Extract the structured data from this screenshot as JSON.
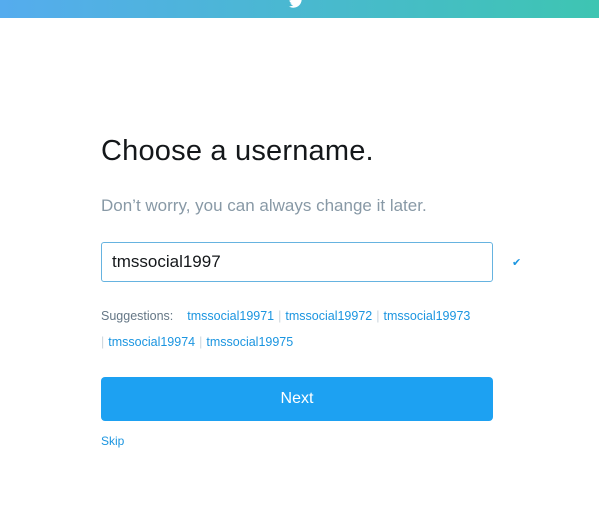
{
  "header": {
    "logo_icon": "twitter-bird-icon",
    "gradient_start": "#55acee",
    "gradient_end": "#3ec5b2"
  },
  "main": {
    "title": "Choose a username.",
    "subtitle": "Don’t worry, you can always change it later.",
    "username_value": "tmssocial1997",
    "valid_icon": "checkmark-icon",
    "suggestions_label": "Suggestions:",
    "suggestions": [
      "tmssocial19971",
      "tmssocial19972",
      "tmssocial19973",
      "tmssocial19974",
      "tmssocial19975"
    ],
    "next_label": "Next",
    "skip_label": "Skip"
  },
  "colors": {
    "accent": "#1da1f2",
    "link": "#1b95e0"
  }
}
